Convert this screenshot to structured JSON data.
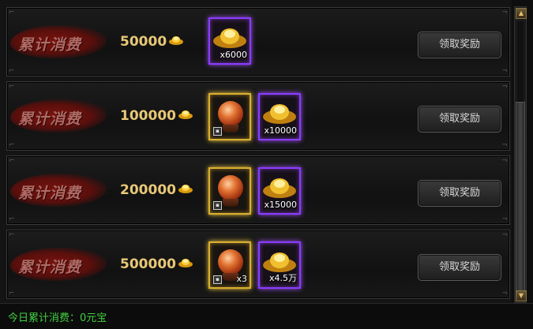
{
  "rows": [
    {
      "label": "累计消费",
      "amount": "50000",
      "rewards": [
        {
          "type": "ingot",
          "frame": "purple",
          "quantity": "x6000",
          "locked": false
        }
      ],
      "button_label": "领取奖励"
    },
    {
      "label": "累计消费",
      "amount": "100000",
      "rewards": [
        {
          "type": "orb",
          "frame": "gold",
          "quantity": "",
          "locked": true
        },
        {
          "type": "ingot",
          "frame": "purple",
          "quantity": "x10000",
          "locked": false
        }
      ],
      "button_label": "领取奖励"
    },
    {
      "label": "累计消费",
      "amount": "200000",
      "rewards": [
        {
          "type": "orb",
          "frame": "gold",
          "quantity": "",
          "locked": true
        },
        {
          "type": "ingot",
          "frame": "purple",
          "quantity": "x15000",
          "locked": false
        }
      ],
      "button_label": "领取奖励"
    },
    {
      "label": "累计消费",
      "amount": "500000",
      "rewards": [
        {
          "type": "orb",
          "frame": "gold",
          "quantity": "x3",
          "locked": true
        },
        {
          "type": "ingot",
          "frame": "purple",
          "quantity": "x4.5万",
          "locked": false
        }
      ],
      "button_label": "领取奖励"
    }
  ],
  "footer": {
    "status_text": "今日累计消费：0元宝"
  },
  "colors": {
    "amount_text": "#e8c878",
    "footer_text": "#40d040",
    "purple_frame": "#8a3cff",
    "gold_frame": "#d8b030"
  },
  "icons": {
    "currency": "gold-ingot-icon",
    "orb": "red-orb-icon",
    "lock": "lock-icon"
  }
}
